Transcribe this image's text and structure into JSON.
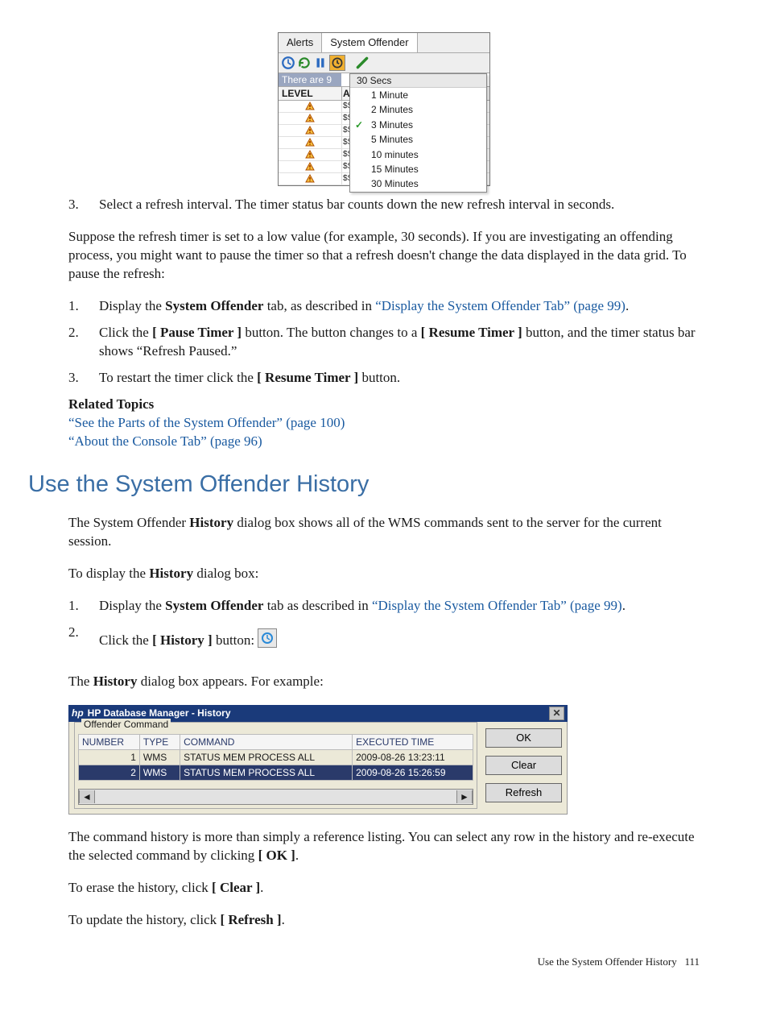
{
  "shot1": {
    "tabs": [
      "Alerts",
      "System Offender"
    ],
    "toolbar_icons": [
      "history-icon",
      "refresh-icon",
      "pause-icon",
      "timer-dropdown-icon",
      "properties-icon"
    ],
    "status_left": "There are 9",
    "menu_head": "30 Secs",
    "menu_items": [
      "1 Minute",
      "2 Minutes",
      "3 Minutes",
      "5 Minutes",
      "10 minutes",
      "15 Minutes",
      "30 Minutes"
    ],
    "menu_checked_index": 2,
    "headers": {
      "level": "LEVEL",
      "a": "A"
    },
    "row_types": [
      "$S",
      "$S",
      "$S",
      "$S",
      "$S",
      "$S",
      "$S"
    ]
  },
  "body": {
    "step3": "Select a refresh interval. The timer status bar counts down the new refresh interval in seconds.",
    "para1": "Suppose the refresh timer is set to a low value (for example, 30 seconds). If you are investigating an offending process, you might want to pause the timer so that a refresh doesn't change the data displayed in the data grid. To pause the refresh:",
    "pause_steps": {
      "s1a": "Display the ",
      "s1b": "System Offender",
      "s1c": " tab, as described in ",
      "s1link": "“Display the System Offender Tab” (page 99)",
      "s1d": ".",
      "s2a": "Click the ",
      "s2b": "[ Pause Timer ]",
      "s2c": " button. The button changes to a ",
      "s2d": "[ Resume Timer ]",
      "s2e": " button, and the timer status bar shows “Refresh Paused.”",
      "s3a": "To restart the timer click the ",
      "s3b": "[ Resume Timer ]",
      "s3c": " button."
    },
    "related_head": "Related Topics",
    "related1": "“See the Parts of the System Offender” (page 100)",
    "related2": "“About the Console Tab” (page 96)",
    "section_heading": "Use the System Offender History",
    "sec_p1a": "The System Offender ",
    "sec_p1b": "History",
    "sec_p1c": " dialog box shows all of the WMS commands sent to the server for the current session.",
    "sec_p2a": "To display the ",
    "sec_p2b": "History",
    "sec_p2c": " dialog box:",
    "hist_steps": {
      "s1a": "Display the ",
      "s1b": "System Offender",
      "s1c": " tab as described in ",
      "s1link": "“Display the System Offender Tab” (page 99)",
      "s1d": ".",
      "s2a": "Click the ",
      "s2b": "[ History ]",
      "s2c": " button:"
    },
    "after_dlg": "The ",
    "after_dlg_b": "History",
    "after_dlg_c": " dialog box appears. For example:",
    "p_cmd1": "The command history is more than simply a reference listing. You can select any row in the history and re-execute the selected command by clicking ",
    "p_cmd1b": "[ OK ]",
    "p_cmd1c": ".",
    "p_cmd2a": "To erase the history, click ",
    "p_cmd2b": "[ Clear ]",
    "p_cmd2c": ".",
    "p_cmd3a": "To update the history, click ",
    "p_cmd3b": "[ Refresh ]",
    "p_cmd3c": "."
  },
  "dialog": {
    "title": "HP Database Manager - History",
    "group_label": "Offender Command",
    "headers": [
      "NUMBER",
      "TYPE",
      "COMMAND",
      "EXECUTED TIME"
    ],
    "rows": [
      {
        "number": "1",
        "type": "WMS",
        "command": "STATUS MEM PROCESS ALL",
        "executed": "2009-08-26 13:23:11",
        "selected": false
      },
      {
        "number": "2",
        "type": "WMS",
        "command": "STATUS MEM PROCESS ALL",
        "executed": "2009-08-26 15:26:59",
        "selected": true
      }
    ],
    "buttons": {
      "ok": "OK",
      "clear": "Clear",
      "refresh": "Refresh"
    }
  },
  "footer": {
    "text": "Use the System Offender History",
    "page": "111"
  }
}
